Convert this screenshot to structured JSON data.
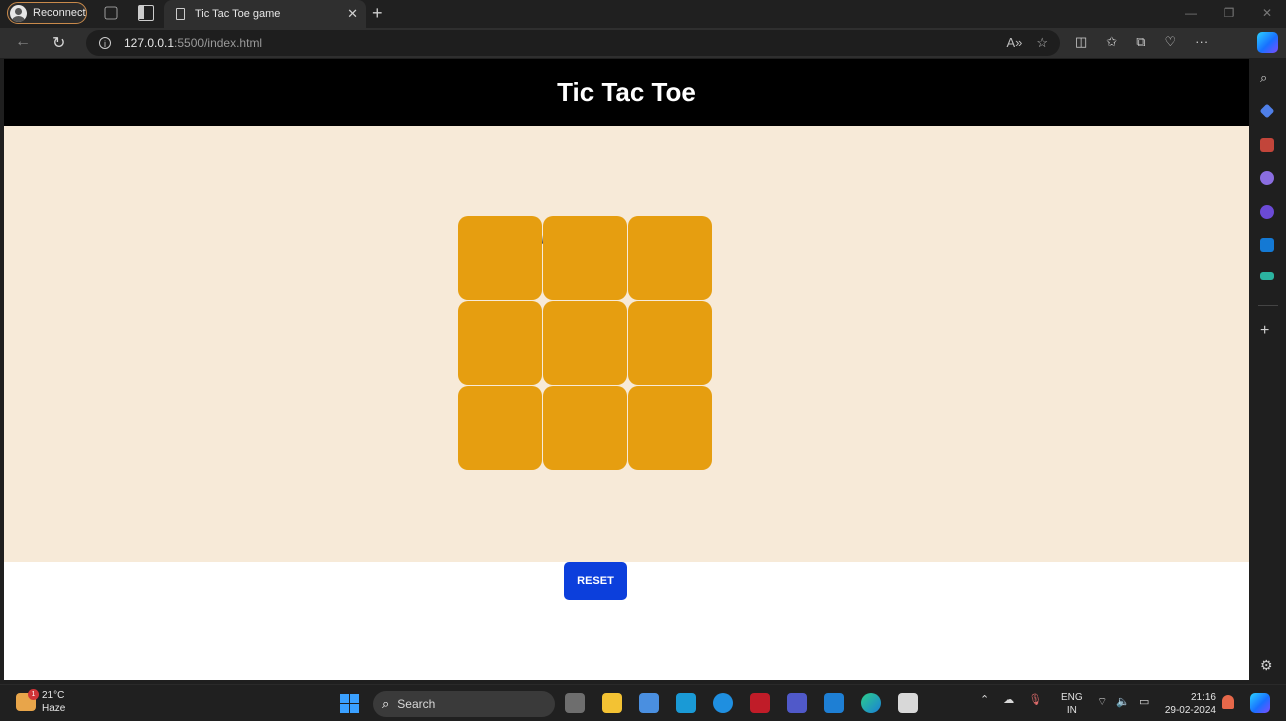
{
  "browser": {
    "reconnect_label": "Reconnect",
    "tab_title": "Tic Tac Toe game",
    "url_host": "127.0.0.1",
    "url_path": ":5500/index.html"
  },
  "app": {
    "title": "Tic Tac Toe",
    "cells": [
      "",
      "",
      "",
      "",
      "",
      "",
      "",
      "",
      ""
    ],
    "reset_label": "RESET",
    "colors": {
      "header_bg": "#000000",
      "board_bg": "#f7ead8",
      "cell": "#e69e10",
      "reset_button": "#0c3fdc"
    }
  },
  "taskbar": {
    "weather_temp": "21°C",
    "weather_desc": "Haze",
    "weather_badge": "1",
    "search_placeholder": "Search",
    "lang_top": "ENG",
    "lang_bottom": "IN",
    "time": "21:16",
    "date": "29-02-2024"
  }
}
